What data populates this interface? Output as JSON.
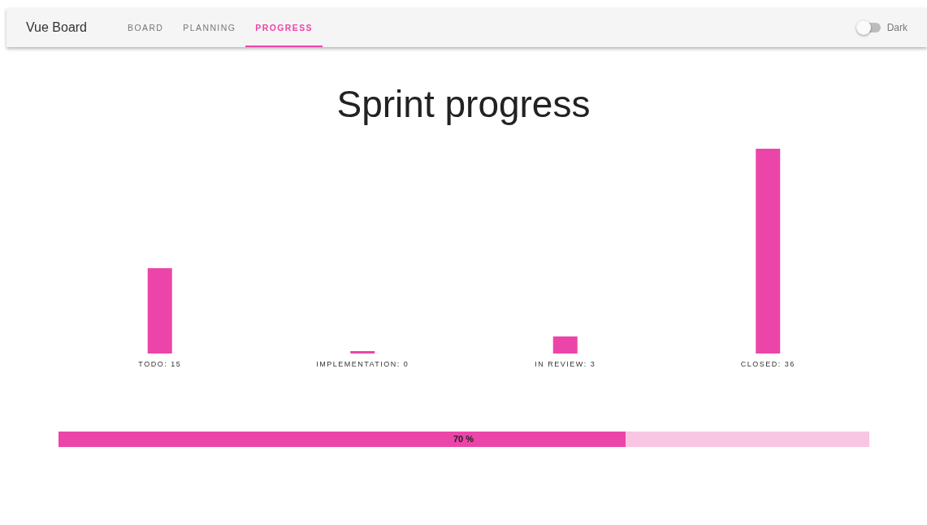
{
  "app_title": "Vue Board",
  "tabs": [
    {
      "label": "BOARD",
      "selected": false
    },
    {
      "label": "PLANNING",
      "selected": false
    },
    {
      "label": "PROGRESS",
      "selected": true
    }
  ],
  "dark_toggle": {
    "label": "Dark",
    "on": false
  },
  "heading": "Sprint progress",
  "chart_data": {
    "type": "bar",
    "categories": [
      "TODO",
      "IMPLEMENTATION",
      "IN REVIEW",
      "CLOSED"
    ],
    "values": [
      15,
      0,
      3,
      36
    ],
    "value_labels": [
      ": 15",
      ": 0",
      ": 3",
      ": 36"
    ],
    "color": "#ec45a9"
  },
  "progress": {
    "level": 0.7,
    "label": "70 %"
  }
}
